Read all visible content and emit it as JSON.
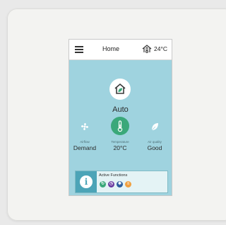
{
  "header": {
    "menu_icon": "hamburger-icon",
    "title": "Home",
    "status_icon": "house-thermometer-icon",
    "temperature": "24°C"
  },
  "mode": {
    "icon": "house-leaf-icon",
    "label": "Auto"
  },
  "controls": [
    {
      "icon": "fan-icon",
      "caption": "Airflow",
      "value": "Demand"
    },
    {
      "icon": "thermometer-icon",
      "caption": "Temperature",
      "value": "20°C"
    },
    {
      "icon": "leaf-icon",
      "caption": "Air quality",
      "value": "Good"
    }
  ],
  "active_functions": {
    "title": "Active Functions",
    "info_icon": "info-icon",
    "icons": [
      {
        "name": "eco-function-icon",
        "color": "#3aa87a"
      },
      {
        "name": "timer-function-icon",
        "color": "#6a3aa0"
      },
      {
        "name": "frost-function-icon",
        "color": "#2c5d9e"
      },
      {
        "name": "filter-function-icon",
        "color": "#f0a040"
      }
    ]
  }
}
